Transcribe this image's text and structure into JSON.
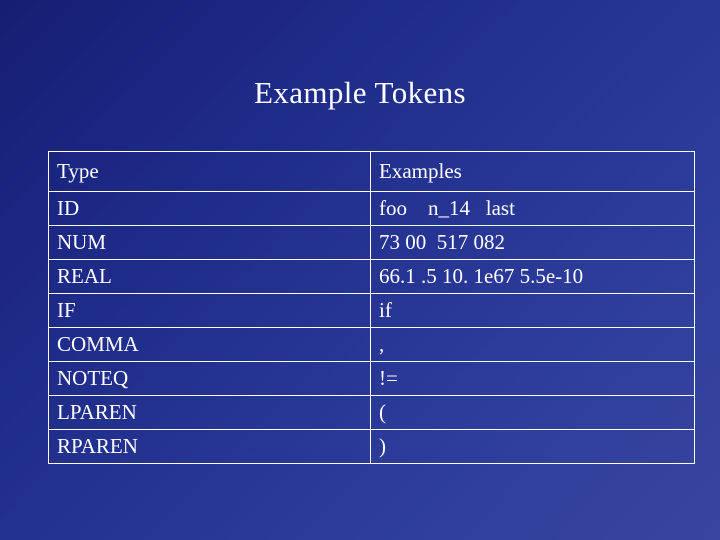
{
  "slide": {
    "title": "Example Tokens",
    "background_color": "#26318c",
    "text_color": "#ffffff"
  },
  "table": {
    "headers": [
      "Type",
      "Examples"
    ],
    "rows": [
      {
        "type": "ID",
        "examples": "foo    n_14   last"
      },
      {
        "type": "NUM",
        "examples": "73 00  517 082"
      },
      {
        "type": "REAL",
        "examples": "66.1 .5 10. 1e67 5.5e-10"
      },
      {
        "type": "IF",
        "examples": "if"
      },
      {
        "type": "COMMA",
        "examples": ","
      },
      {
        "type": "NOTEQ",
        "examples": "!="
      },
      {
        "type": "LPAREN",
        "examples": "("
      },
      {
        "type": "RPAREN",
        "examples": ")"
      }
    ]
  }
}
